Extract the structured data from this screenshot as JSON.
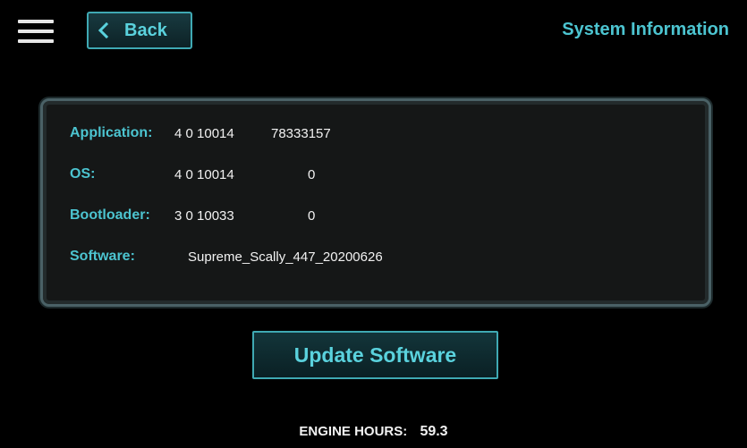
{
  "header": {
    "back_label": "Back",
    "title": "System Information"
  },
  "info": {
    "application": {
      "label": "Application:",
      "version": "4 0 10014",
      "build": "78333157"
    },
    "os": {
      "label": "OS:",
      "version": "4 0 10014",
      "build": "0"
    },
    "bootloader": {
      "label": "Bootloader:",
      "version": "3 0 10033",
      "build": "0"
    },
    "software": {
      "label": "Software:",
      "value": "Supreme_Scally_447_20200626"
    }
  },
  "actions": {
    "update_label": "Update Software"
  },
  "footer": {
    "engine_hours_label": "ENGINE HOURS:",
    "engine_hours_value": "59.3"
  },
  "colors": {
    "accent": "#4cc4d0",
    "button_border": "#3fa9b3",
    "background": "#000000"
  },
  "icons": [
    "menu-icon",
    "chevron-left-icon"
  ]
}
